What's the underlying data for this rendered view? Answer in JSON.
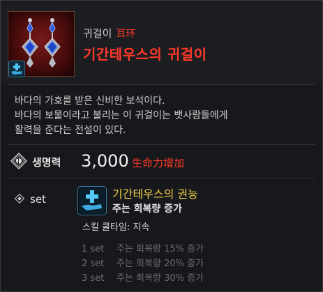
{
  "item": {
    "type": "귀걸이",
    "type_cn": "耳环",
    "name": "기간테우스의 귀걸이",
    "icon": "earring-icon",
    "badge_icon": "plus-hand-icon"
  },
  "description": [
    "바다의 가호를 받은 신비한 보석이다.",
    "바다의 보물이라고 불리는 이 귀걸이는 뱃사람들에게",
    "활력을 준다는 전설이 있다."
  ],
  "stat": {
    "label": "생명력",
    "value": "3,000",
    "note": "生命力增加",
    "icon": "health-icon"
  },
  "set": {
    "label": "set",
    "skill_name": "기간테우스의 권능",
    "skill_desc": "주는 회복량 증가",
    "cooldown": "스킬 쿨타임: 지속",
    "skill_icon": "plus-hand-icon",
    "tiers": [
      {
        "count": "1 set",
        "effect": "주는 회복량 15% 증가"
      },
      {
        "count": "2 set",
        "effect": "주는 회복량 20% 증가"
      },
      {
        "count": "3 set",
        "effect": "주는 회복량 30% 증가"
      }
    ]
  },
  "colors": {
    "accent_red": "#ff3a2a",
    "skill_gold": "#f0d04a",
    "inactive_gray": "#6a6c70"
  }
}
